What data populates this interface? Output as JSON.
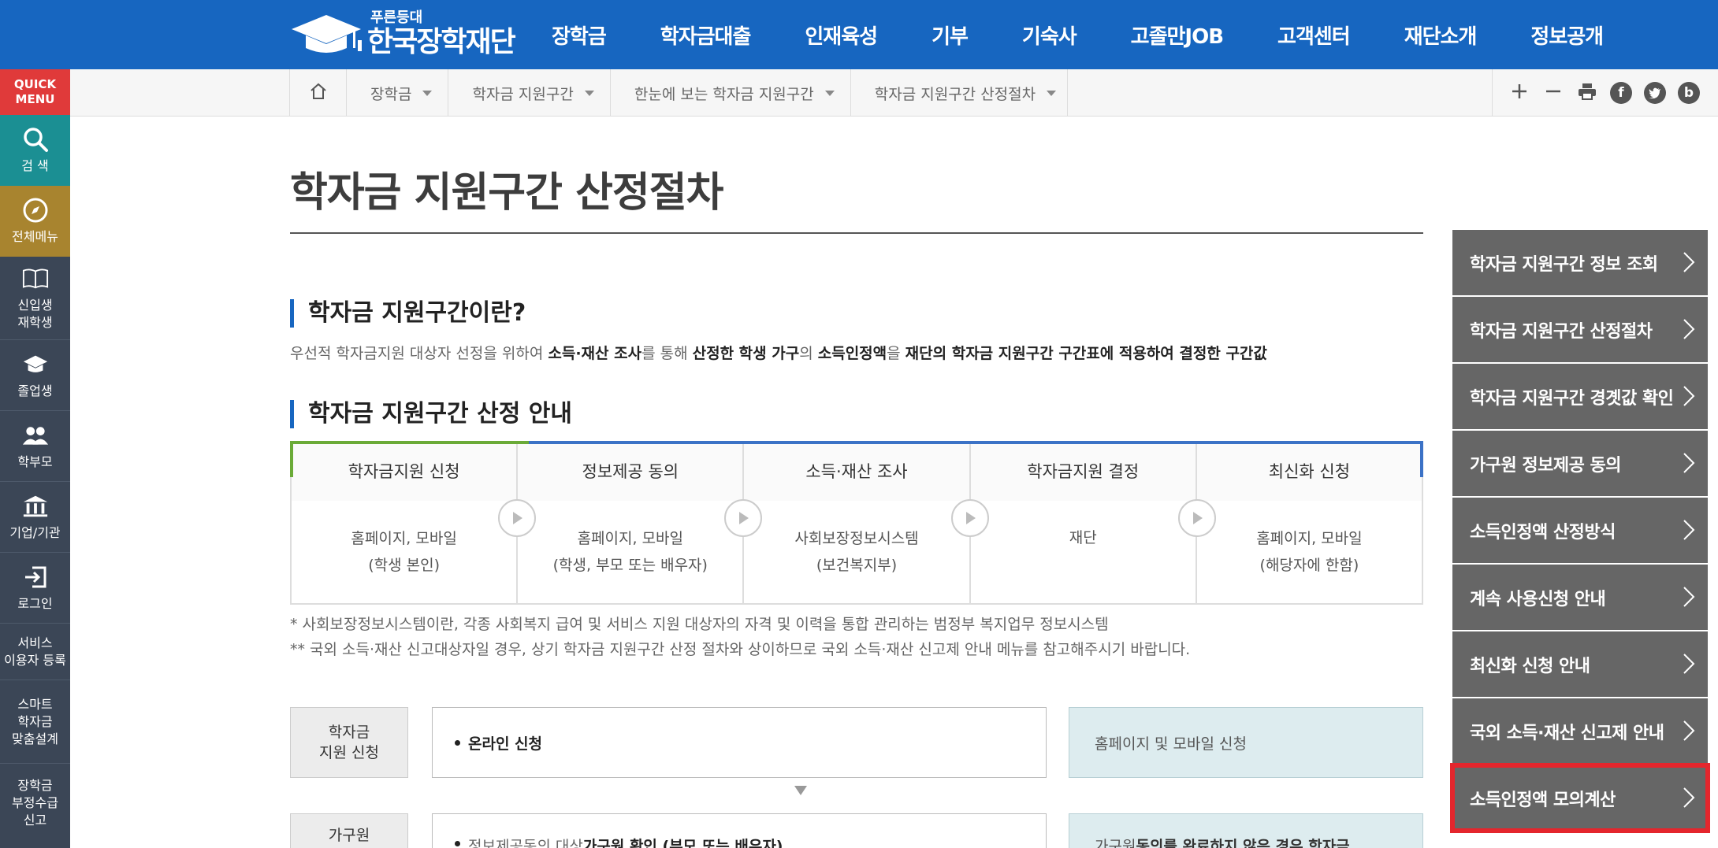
{
  "header": {
    "logo_small": "푸른등대",
    "logo_main": "한국장학재단",
    "nav": [
      "장학금",
      "학자금대출",
      "인재육성",
      "기부",
      "기숙사",
      "고졸만JOB",
      "고객센터",
      "재단소개",
      "정보공개"
    ]
  },
  "quick": {
    "head_line1": "QUICK",
    "head_line2": "MENU",
    "items": [
      {
        "line1": "검 색",
        "line2": "",
        "line3": ""
      },
      {
        "line1": "전체메뉴",
        "line2": "",
        "line3": ""
      },
      {
        "line1": "신입생",
        "line2": "재학생",
        "line3": ""
      },
      {
        "line1": "졸업생",
        "line2": "",
        "line3": ""
      },
      {
        "line1": "학부모",
        "line2": "",
        "line3": ""
      },
      {
        "line1": "기업/기관",
        "line2": "",
        "line3": ""
      },
      {
        "line1": "로그인",
        "line2": "",
        "line3": ""
      },
      {
        "line1": "서비스",
        "line2": "이용자 등록",
        "line3": ""
      },
      {
        "line1": "스마트",
        "line2": "학자금",
        "line3": "맞춤설계"
      },
      {
        "line1": "장학금",
        "line2": "부정수급",
        "line3": "신고"
      }
    ]
  },
  "breadcrumb": [
    "장학금",
    "학자금 지원구간",
    "한눈에 보는 학자금 지원구간",
    "학자금 지원구간 산정절차"
  ],
  "page": {
    "title": "학자금 지원구간 산정절차",
    "sec1_title": "학자금 지원구간이란?",
    "desc": {
      "p1": "우선적 학자금지원 대상자 선정을 위하여 ",
      "b1": "소득·재산 조사",
      "p2": "를 통해 ",
      "b2": "산정한 학생 가구",
      "p3": "의 ",
      "b3": "소득인정액",
      "p4": "을 ",
      "b4": "재단의 학자금 지원구간 구간표에 적용하여 결정한 구간값"
    },
    "sec2_title": "학자금 지원구간 산정 안내",
    "steps": [
      {
        "head": "학자금지원 신청",
        "line1": "홈페이지, 모바일",
        "line2": "(학생 본인)"
      },
      {
        "head": "정보제공 동의",
        "line1": "홈페이지, 모바일",
        "line2": "(학생, 부모 또는 배우자)"
      },
      {
        "head": "소득·재산 조사",
        "line1": "사회보장정보시스템",
        "line2": "(보건복지부)"
      },
      {
        "head": "학자금지원 결정",
        "line1": "재단",
        "line2": ""
      },
      {
        "head": "최신화 신청",
        "line1": "홈페이지, 모바일",
        "line2": "(해당자에 한함)"
      }
    ],
    "note1": "* 사회보장정보시스템이란, 각종 사회복지 급여 및 서비스 지원 대상자의 자격 및 이력을 통합 관리하는 범정부 복지업무 정보시스템",
    "note2": "** 국외 소득·재산 신고대상자일 경우, 상기 학자금 지원구간 산정 절차와 상이하므로 국외 소득·재산 신고제 안내 메뉴를 참고해주시기 바랍니다.",
    "process": [
      {
        "label1": "학자금",
        "label2": "지원 신청",
        "box": "온라인 신청",
        "side": "홈페이지 및 모바일 신청"
      },
      {
        "label1": "가구원",
        "label2": "",
        "box_p": "정보제공동의 대상 ",
        "box_b": "가구원 확인 (부모 또는 배우자)",
        "side_p1": "가구원 ",
        "side_b": "동의를 완료하지 않은 경우 학자금"
      }
    ]
  },
  "side_menu": [
    "학자금 지원구간 정보 조회",
    "학자금 지원구간 산정절차",
    "학자금 지원구간 경곗값 확인",
    "가구원 정보제공 동의",
    "소득인정액 산정방식",
    "계속 사용신청 안내",
    "최신화 신청 안내",
    "국외 소득·재산 신고제 안내",
    "소득인정액 모의계산"
  ],
  "colors": {
    "header_blue": "#1766c0",
    "active_outline": "#e4262d",
    "quick_red": "#e03a3a",
    "quick_teal": "#1b8f93",
    "quick_gold": "#a8842f"
  }
}
